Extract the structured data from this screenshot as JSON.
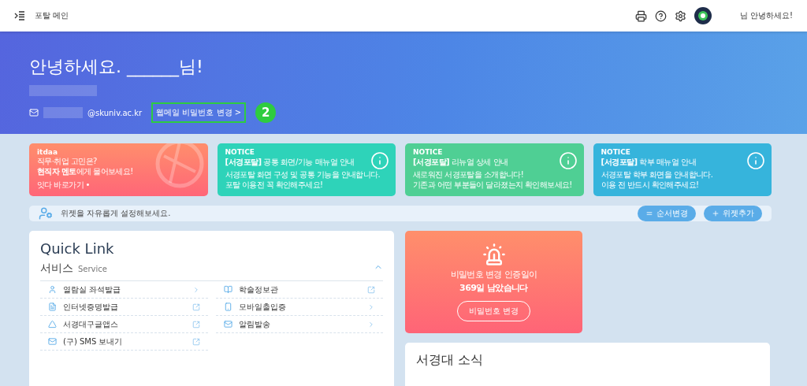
{
  "topbar": {
    "title": "포탈 메인",
    "greeting": "님 안녕하세요!"
  },
  "hero": {
    "greeting": "안녕하세요. ______님!",
    "email_domain": "@skuniv.ac.kr",
    "password_link": "웹메일 비밀번호 변경 >",
    "step_badge": "2"
  },
  "promo": {
    "brand": "itdaa",
    "line1": "직무·취업 고민은?",
    "line2": "**현직자 멘토**에게 물어보세요!",
    "link": "잇다 바로가기 •"
  },
  "notices": [
    {
      "label": "NOTICE",
      "title": "**[서경포탈]** 공통 화면/기능 매뉴얼 안내",
      "body": [
        "서경포탈 화면 구성 및 공통 기능을 안내합니다.",
        "포탈 이용전 꼭 확인해주세요!"
      ],
      "color": "#2ed3b9"
    },
    {
      "label": "NOTICE",
      "title": "**[서경포탈]** 리뉴얼 상세 안내",
      "body": [
        "새로워진 서경포탈을 소개합니다!",
        "기존과 어떤 부분들이 달라졌는지 확인해보세요!"
      ],
      "color": "#4fcf94"
    },
    {
      "label": "NOTICE",
      "title": "**[서경포탈]** 학부 매뉴얼 안내",
      "body": [
        "서경포탈 학부 화면을 안내합니다.",
        "이용 전 반드시 확인해주세요!"
      ],
      "color": "#36b4dc"
    }
  ],
  "widget_bar": {
    "hint": "위젯을 자유롭게 설정해보세요.",
    "buttons": [
      {
        "label": "순서변경",
        "kind": "reorder"
      },
      {
        "label": "위젯추가",
        "kind": "add"
      }
    ]
  },
  "quick_link": {
    "title": "Quick Link",
    "section": {
      "name": "서비스",
      "sub": "Service",
      "expanded": true
    },
    "items": [
      {
        "label": "열람실 좌석발급",
        "kind": "arrow"
      },
      {
        "label": "학술정보관",
        "kind": "external"
      },
      {
        "label": "인터넷증명발급",
        "kind": "external"
      },
      {
        "label": "모바일출입증",
        "kind": "arrow"
      },
      {
        "label": "서경대구글앱스",
        "kind": "external"
      },
      {
        "label": "알림발송",
        "kind": "arrow"
      },
      {
        "label": "(구) SMS 보내기",
        "kind": "external"
      }
    ]
  },
  "password_alert": {
    "line1": "비밀번호 변경 인증일이",
    "line2": "369일 남았습니다",
    "button": "비밀번호 변경"
  },
  "news": {
    "title": "서경대 소식"
  }
}
